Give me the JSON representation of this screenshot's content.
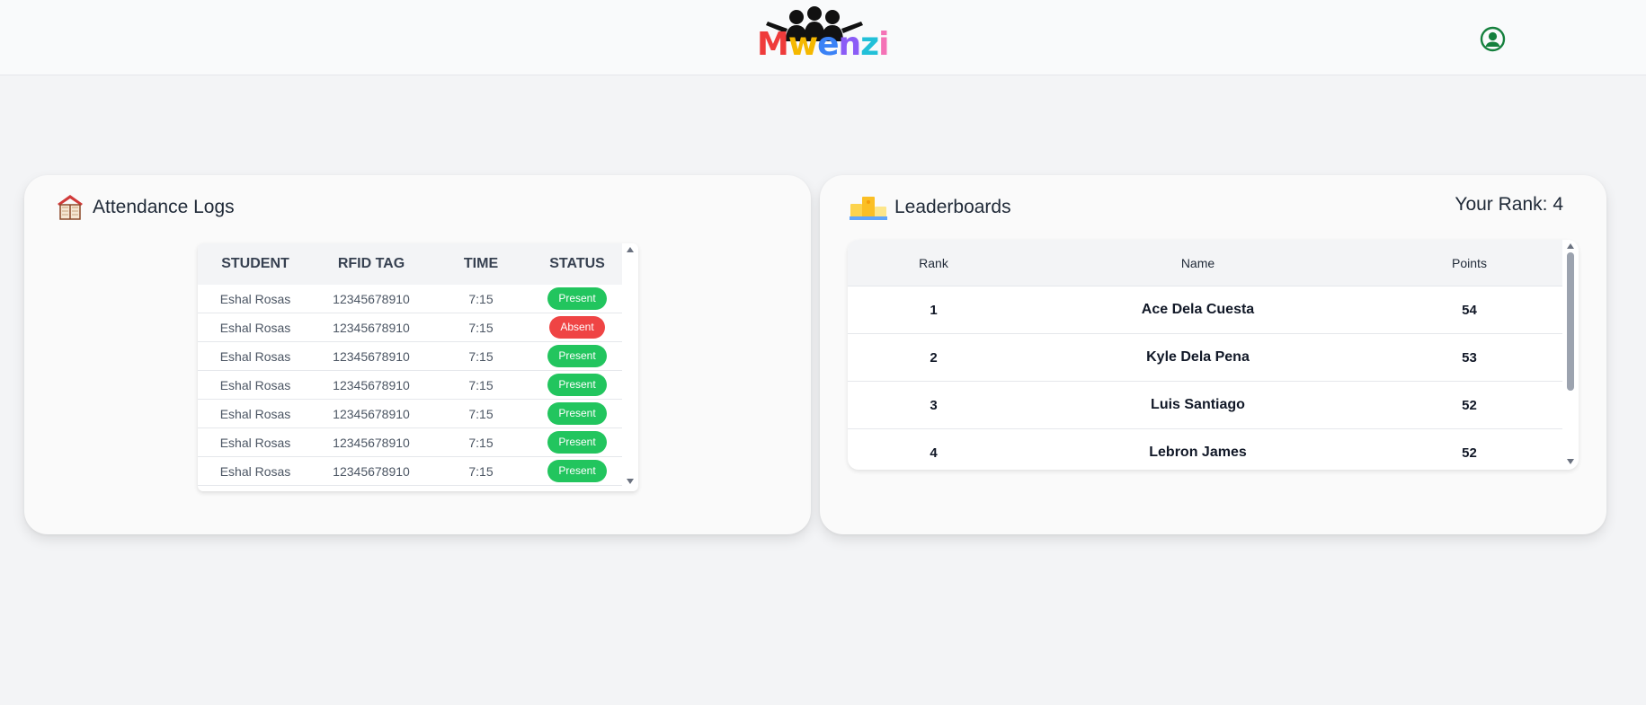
{
  "header": {
    "logo_text": "Mwenzi",
    "logo_letter_colors": [
      "#ef3b3b",
      "#f5b800",
      "#3b82f6",
      "#8b5cf6",
      "#22c0d8",
      "#f472b6"
    ],
    "profile_icon": "user-circle-icon"
  },
  "attendance": {
    "title": "Attendance Logs",
    "icon": "book-house-icon",
    "columns": [
      "STUDENT",
      "RFID TAG",
      "TIME",
      "STATUS"
    ],
    "rows": [
      {
        "student": "Eshal Rosas",
        "rfid": "12345678910",
        "time": "7:15",
        "status": "Present"
      },
      {
        "student": "Eshal Rosas",
        "rfid": "12345678910",
        "time": "7:15",
        "status": "Absent"
      },
      {
        "student": "Eshal Rosas",
        "rfid": "12345678910",
        "time": "7:15",
        "status": "Present"
      },
      {
        "student": "Eshal Rosas",
        "rfid": "12345678910",
        "time": "7:15",
        "status": "Present"
      },
      {
        "student": "Eshal Rosas",
        "rfid": "12345678910",
        "time": "7:15",
        "status": "Present"
      },
      {
        "student": "Eshal Rosas",
        "rfid": "12345678910",
        "time": "7:15",
        "status": "Present"
      },
      {
        "student": "Eshal Rosas",
        "rfid": "12345678910",
        "time": "7:15",
        "status": "Present"
      }
    ],
    "status_colors": {
      "Present": "#22c55e",
      "Absent": "#ef4444"
    }
  },
  "leaderboard": {
    "title": "Leaderboards",
    "icon": "podium-icon",
    "your_rank": "Your Rank: 4",
    "columns": [
      "Rank",
      "Name",
      "Points"
    ],
    "rows": [
      {
        "rank": "1",
        "name": "Ace Dela Cuesta",
        "points": "54"
      },
      {
        "rank": "2",
        "name": "Kyle Dela Pena",
        "points": "53"
      },
      {
        "rank": "3",
        "name": "Luis Santiago",
        "points": "52"
      },
      {
        "rank": "4",
        "name": "Lebron James",
        "points": "52"
      }
    ]
  }
}
